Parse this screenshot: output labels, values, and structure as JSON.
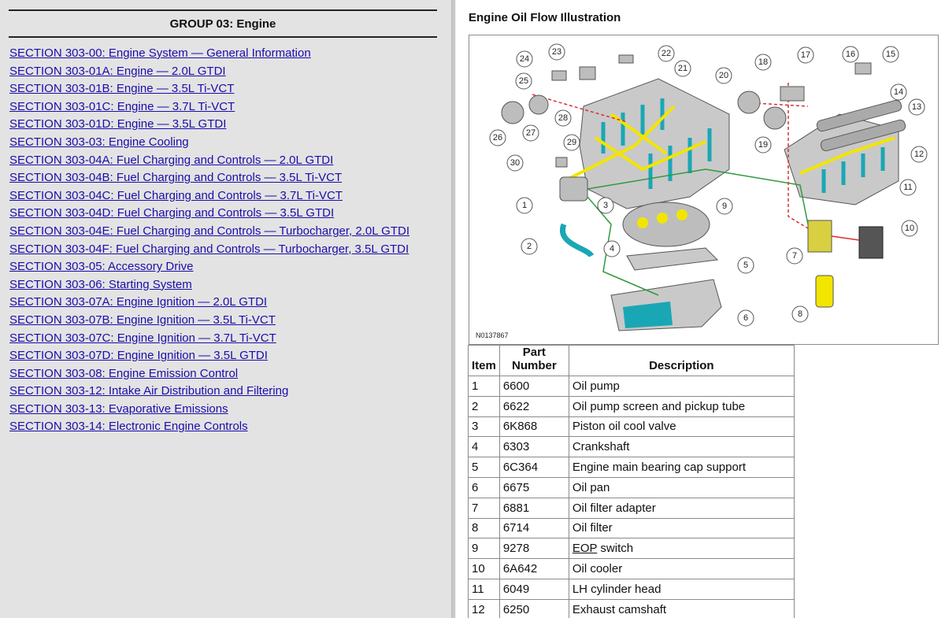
{
  "nav": {
    "group_title": "GROUP 03: Engine",
    "sections": [
      "SECTION 303-00: Engine System — General Information",
      "SECTION 303-01A: Engine — 2.0L GTDI",
      "SECTION 303-01B: Engine — 3.5L Ti-VCT",
      "SECTION 303-01C: Engine — 3.7L Ti-VCT",
      "SECTION 303-01D: Engine — 3.5L GTDI",
      "SECTION 303-03: Engine Cooling",
      "SECTION 303-04A: Fuel Charging and Controls — 2.0L GTDI",
      "SECTION 303-04B: Fuel Charging and Controls — 3.5L Ti-VCT",
      "SECTION 303-04C: Fuel Charging and Controls — 3.7L Ti-VCT",
      "SECTION 303-04D: Fuel Charging and Controls — 3.5L GTDI",
      "SECTION 303-04E: Fuel Charging and Controls — Turbocharger, 2.0L GTDI",
      "SECTION 303-04F: Fuel Charging and Controls — Turbocharger, 3.5L GTDI",
      "SECTION 303-05: Accessory Drive",
      "SECTION 303-06: Starting System",
      "SECTION 303-07A: Engine Ignition — 2.0L GTDI",
      "SECTION 303-07B: Engine Ignition — 3.5L Ti-VCT",
      "SECTION 303-07C: Engine Ignition — 3.7L Ti-VCT",
      "SECTION 303-07D: Engine Ignition — 3.5L GTDI",
      "SECTION 303-08: Engine Emission Control",
      "SECTION 303-12: Intake Air Distribution and Filtering",
      "SECTION 303-13: Evaporative Emissions",
      "SECTION 303-14: Electronic Engine Controls"
    ]
  },
  "illustration": {
    "title": "Engine Oil Flow Illustration",
    "figure_code": "N0137867",
    "callouts": [
      "1",
      "2",
      "3",
      "4",
      "5",
      "6",
      "7",
      "8",
      "9",
      "10",
      "11",
      "12",
      "13",
      "14",
      "15",
      "16",
      "17",
      "18",
      "19",
      "20",
      "21",
      "22",
      "23",
      "24",
      "25",
      "26",
      "27",
      "28",
      "29",
      "30"
    ]
  },
  "table": {
    "headers": {
      "item": "Item",
      "part_number": "Part Number",
      "description": "Description"
    },
    "rows": [
      {
        "item": "1",
        "part": "6600",
        "desc": "Oil pump"
      },
      {
        "item": "2",
        "part": "6622",
        "desc": "Oil pump screen and pickup tube"
      },
      {
        "item": "3",
        "part": "6K868",
        "desc": "Piston oil cool valve"
      },
      {
        "item": "4",
        "part": "6303",
        "desc": "Crankshaft"
      },
      {
        "item": "5",
        "part": "6C364",
        "desc": "Engine main bearing cap support"
      },
      {
        "item": "6",
        "part": "6675",
        "desc": "Oil pan"
      },
      {
        "item": "7",
        "part": "6881",
        "desc": "Oil filter adapter"
      },
      {
        "item": "8",
        "part": "6714",
        "desc": "Oil filter"
      },
      {
        "item": "9",
        "part": "9278",
        "desc_abbr": "EOP",
        "desc_rest": " switch"
      },
      {
        "item": "10",
        "part": "6A642",
        "desc": "Oil cooler"
      },
      {
        "item": "11",
        "part": "6049",
        "desc": "LH cylinder head"
      },
      {
        "item": "12",
        "part": "6250",
        "desc": "Exhaust camshaft"
      }
    ]
  },
  "colors": {
    "link": "#1a0dab",
    "left_panel_bg": "#e3e3e3",
    "oil_yellow": "#f2e500",
    "oil_cyan": "#1aa7b5",
    "flow_red": "#d9302c",
    "flow_green": "#2e9b3e"
  }
}
